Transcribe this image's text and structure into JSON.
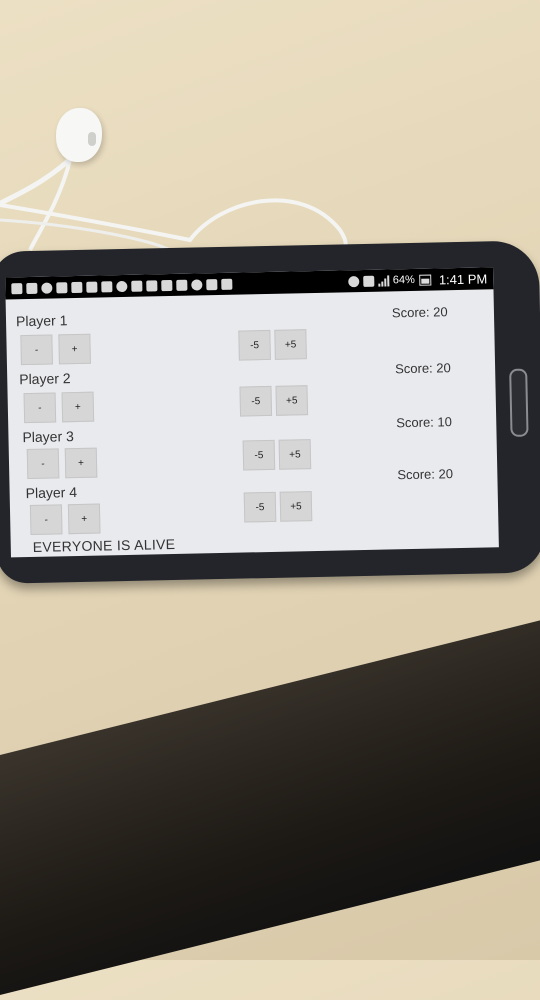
{
  "status_bar": {
    "left_icons": [
      "usb-icon",
      "voicemail-icon",
      "skype-icon",
      "facebook-icon",
      "music-icon",
      "calendar-icon",
      "linkedin-icon",
      "sync-icon",
      "flipboard-icon",
      "linkedin-icon",
      "file-icon",
      "wifi-icon",
      "whatsapp-icon",
      "headphones-icon",
      "bag-icon"
    ],
    "right_icons": [
      "alarm-icon",
      "network-4g-icon",
      "signal-icon",
      "battery-icon"
    ],
    "battery": "64%",
    "clock": "1:41 PM"
  },
  "players": [
    {
      "name": "Player 1",
      "minus": "-",
      "plus": "+",
      "minus5": "-5",
      "plus5": "+5",
      "score": "Score: 20"
    },
    {
      "name": "Player 2",
      "minus": "-",
      "plus": "+",
      "minus5": "-5",
      "plus5": "+5",
      "score": "Score: 20"
    },
    {
      "name": "Player 3",
      "minus": "-",
      "plus": "+",
      "minus5": "-5",
      "plus5": "+5",
      "score": "Score: 10"
    },
    {
      "name": "Player 4",
      "minus": "-",
      "plus": "+",
      "minus5": "-5",
      "plus5": "+5",
      "score": "Score: 20"
    }
  ],
  "status_message": "EVERYONE IS ALIVE",
  "colors": {
    "screen_bg": "#e9eaee",
    "button_bg": "#d6d6d6",
    "phone_body": "#23252b",
    "table": "#e3d5b6"
  }
}
